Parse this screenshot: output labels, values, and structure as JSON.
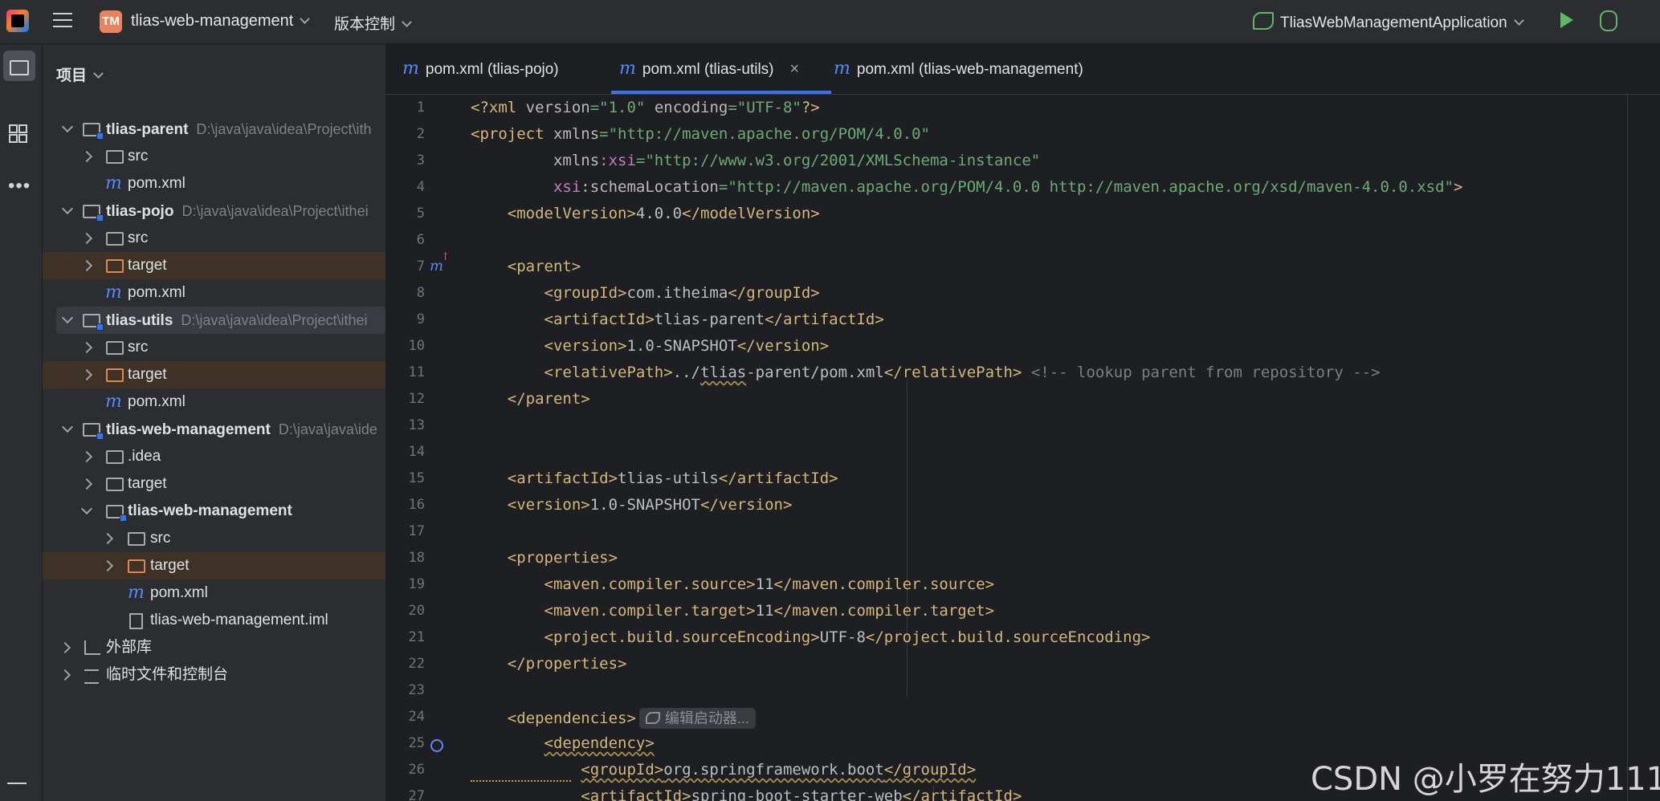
{
  "topbar": {
    "project_badge": "TM",
    "project_name": "tlias-web-management",
    "vcs_label": "版本控制",
    "run_config": "TliasWebManagementApplication"
  },
  "panel": {
    "title": "项目",
    "tree": [
      {
        "label": "tlias-parent",
        "path": "D:\\java\\java\\idea\\Project\\ith"
      },
      {
        "label": "src"
      },
      {
        "label": "pom.xml"
      },
      {
        "label": "tlias-pojo",
        "path": "D:\\java\\java\\idea\\Project\\ithei"
      },
      {
        "label": "src"
      },
      {
        "label": "target"
      },
      {
        "label": "pom.xml"
      },
      {
        "label": "tlias-utils",
        "path": "D:\\java\\java\\idea\\Project\\ithei"
      },
      {
        "label": "src"
      },
      {
        "label": "target"
      },
      {
        "label": "pom.xml"
      },
      {
        "label": "tlias-web-management",
        "path": "D:\\java\\java\\ide"
      },
      {
        "label": ".idea"
      },
      {
        "label": "target"
      },
      {
        "label": "tlias-web-management"
      },
      {
        "label": "src"
      },
      {
        "label": "target"
      },
      {
        "label": "pom.xml"
      },
      {
        "label": "tlias-web-management.iml"
      },
      {
        "label": "外部库"
      },
      {
        "label": "临时文件和控制台"
      }
    ]
  },
  "tabs": [
    {
      "icon": "m",
      "label": "pom.xml (tlias-pojo)"
    },
    {
      "icon": "m",
      "label": "pom.xml (tlias-utils)",
      "close": "×"
    },
    {
      "icon": "m",
      "label": "pom.xml (tlias-web-management)"
    }
  ],
  "editor": {
    "line_numbers": [
      "1",
      "2",
      "3",
      "4",
      "5",
      "6",
      "7",
      "8",
      "9",
      "10",
      "11",
      "12",
      "13",
      "14",
      "15",
      "16",
      "17",
      "18",
      "19",
      "20",
      "21",
      "22",
      "23",
      "24",
      "25",
      "26",
      "27"
    ],
    "inlay_hint": "编辑启动器..."
  },
  "watermark": "CSDN @小罗在努力111"
}
